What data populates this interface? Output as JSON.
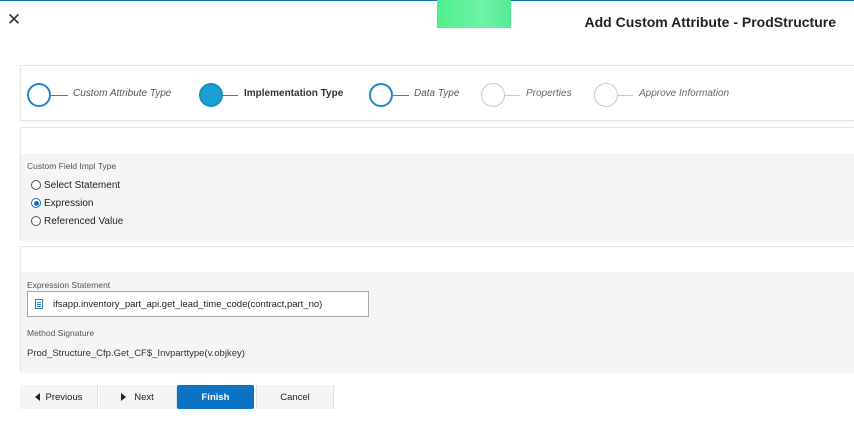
{
  "dialog": {
    "title": "Add Custom Attribute - ProdStructure",
    "close_icon": "close-icon",
    "accent_color": "#0b72c4"
  },
  "stepper": {
    "steps": [
      {
        "label": "Custom Attribute Type",
        "state": "done"
      },
      {
        "label": "Implementation Type",
        "state": "active"
      },
      {
        "label": "Data Type",
        "state": "done"
      },
      {
        "label": "Properties",
        "state": "pending"
      },
      {
        "label": "Approve Information",
        "state": "pending"
      }
    ]
  },
  "impl_type": {
    "label": "Custom Field Impl Type",
    "options": [
      {
        "label": "Select Statement",
        "checked": false
      },
      {
        "label": "Expression",
        "checked": true
      },
      {
        "label": "Referenced Value",
        "checked": false
      }
    ]
  },
  "expression": {
    "label": "Expression Statement",
    "value": "ifsapp.inventory_part_api.get_lead_time_code(contract,part_no)",
    "icon": "document-icon",
    "method_label": "Method Signature",
    "method_value": "Prod_Structure_Cfp.Get_CF$_Invparttype(v.objkey)"
  },
  "buttons": {
    "previous": "Previous",
    "next": "Next",
    "finish": "Finish",
    "cancel": "Cancel"
  }
}
